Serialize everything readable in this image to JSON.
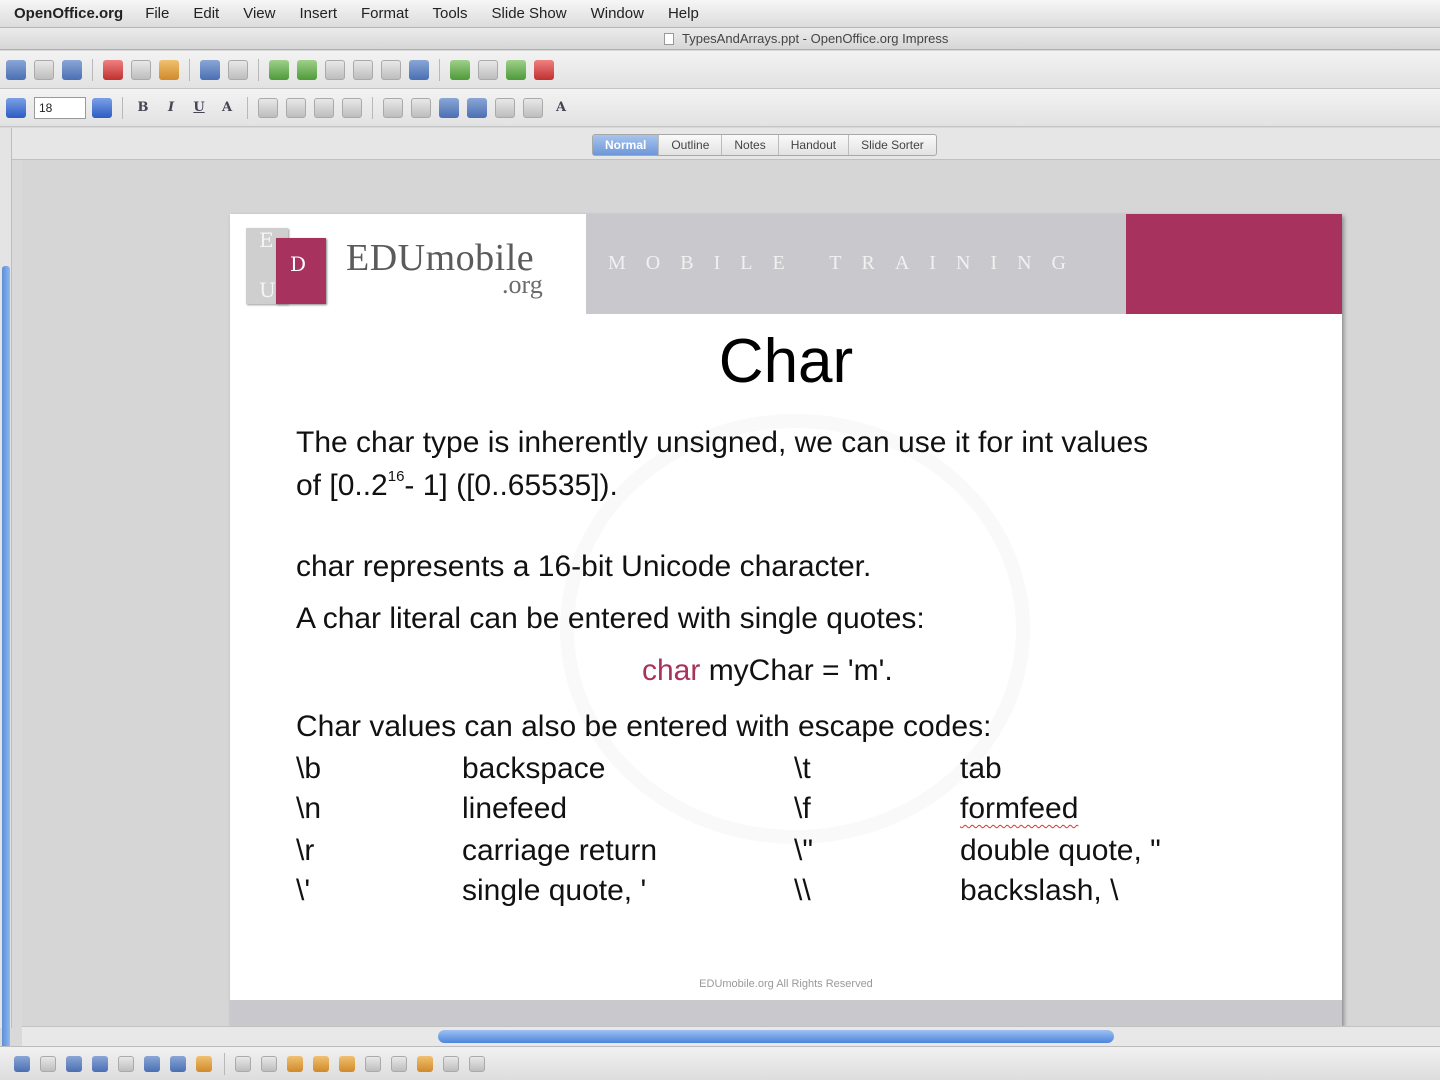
{
  "menubar": {
    "app_name": "OpenOffice.org",
    "items": [
      "File",
      "Edit",
      "View",
      "Insert",
      "Format",
      "Tools",
      "Slide Show",
      "Window",
      "Help"
    ]
  },
  "window": {
    "title": "TypesAndArrays.ppt - OpenOffice.org Impress"
  },
  "formatting": {
    "font_size": "18"
  },
  "view_tabs": [
    "Normal",
    "Outline",
    "Notes",
    "Handout",
    "Slide Sorter"
  ],
  "slide": {
    "logo": {
      "letters": [
        "E",
        "D",
        "U"
      ],
      "name": "EDUmobile",
      "suffix": ".org"
    },
    "banner_text": "MOBILE TRAINING",
    "title": "Char",
    "para1_line1": "The char type is inherently unsigned, we can use it for int values",
    "para1_line2_pre": "of [0..2",
    "para1_sup": "16",
    "para1_line2_post": "- 1] ([0..65535]).",
    "para2": "char represents a 16-bit Unicode character.",
    "para3": "A char literal can be entered with single quotes:",
    "code_keyword": "char",
    "code_rest": " myChar = 'm'.",
    "para4": "Char values can also be entered with escape codes:",
    "escapes": [
      {
        "code1": "\\b",
        "desc1": "backspace",
        "code2": "\\t",
        "desc2": "tab"
      },
      {
        "code1": "\\n",
        "desc1": "linefeed",
        "code2": "\\f",
        "desc2": "formfeed"
      },
      {
        "code1": "\\r",
        "desc1": "carriage return",
        "code2": "\\\"",
        "desc2": "double quote, \""
      },
      {
        "code1": "\\'",
        "desc1": "single quote, '",
        "code2": "\\\\",
        "desc2": "backslash, \\"
      }
    ],
    "footer": "EDUmobile.org All Rights Reserved"
  },
  "colors": {
    "brand_red": "#a8325e",
    "banner_gray": "#c9c9cd",
    "selection_blue": "#4c86dc"
  }
}
